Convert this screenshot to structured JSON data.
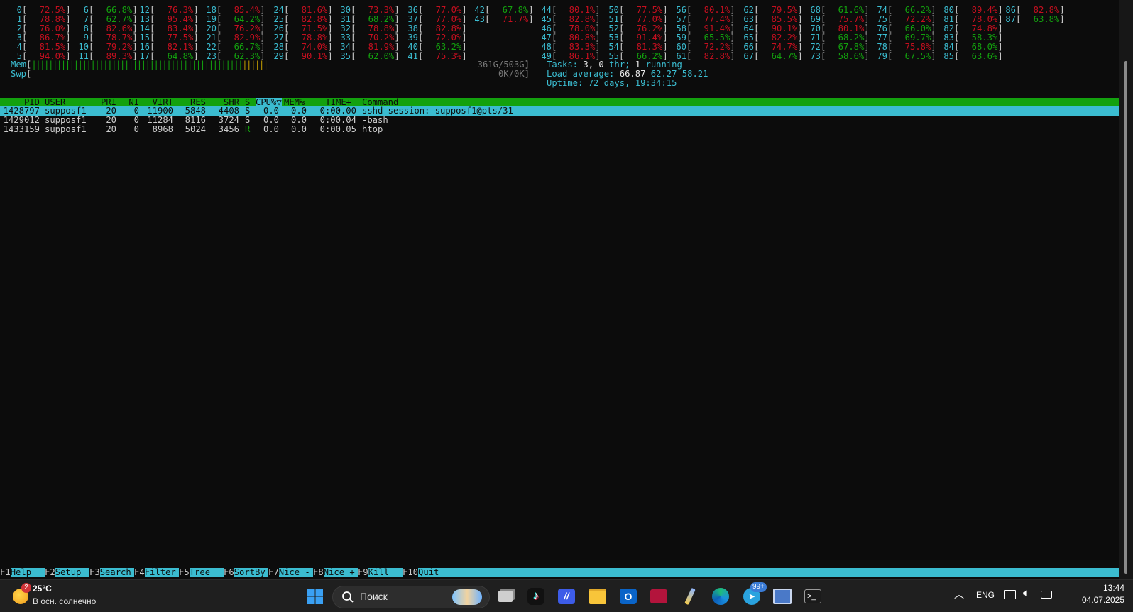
{
  "cpus": [
    {
      "n": "0",
      "v": "72.5%"
    },
    {
      "n": "1",
      "v": "78.8%"
    },
    {
      "n": "2",
      "v": "76.0%"
    },
    {
      "n": "3",
      "v": "86.7%"
    },
    {
      "n": "4",
      "v": "81.5%"
    },
    {
      "n": "5",
      "v": "94.0%"
    },
    {
      "n": "6",
      "v": "66.8%"
    },
    {
      "n": "7",
      "v": "62.7%"
    },
    {
      "n": "8",
      "v": "82.6%"
    },
    {
      "n": "9",
      "v": "78.7%"
    },
    {
      "n": "10",
      "v": "79.2%"
    },
    {
      "n": "11",
      "v": "89.3%"
    },
    {
      "n": "12",
      "v": "76.3%"
    },
    {
      "n": "13",
      "v": "95.4%"
    },
    {
      "n": "14",
      "v": "83.4%"
    },
    {
      "n": "15",
      "v": "77.5%"
    },
    {
      "n": "16",
      "v": "82.1%"
    },
    {
      "n": "17",
      "v": "64.8%"
    },
    {
      "n": "18",
      "v": "85.4%"
    },
    {
      "n": "19",
      "v": "64.2%"
    },
    {
      "n": "20",
      "v": "76.2%"
    },
    {
      "n": "21",
      "v": "82.9%"
    },
    {
      "n": "22",
      "v": "66.7%"
    },
    {
      "n": "23",
      "v": "62.3%"
    },
    {
      "n": "24",
      "v": "81.6%"
    },
    {
      "n": "25",
      "v": "82.8%"
    },
    {
      "n": "26",
      "v": "71.5%"
    },
    {
      "n": "27",
      "v": "78.8%"
    },
    {
      "n": "28",
      "v": "74.0%"
    },
    {
      "n": "29",
      "v": "90.1%"
    },
    {
      "n": "30",
      "v": "73.3%"
    },
    {
      "n": "31",
      "v": "68.2%"
    },
    {
      "n": "32",
      "v": "78.8%"
    },
    {
      "n": "33",
      "v": "70.2%"
    },
    {
      "n": "34",
      "v": "81.9%"
    },
    {
      "n": "35",
      "v": "62.0%"
    },
    {
      "n": "36",
      "v": "77.0%"
    },
    {
      "n": "37",
      "v": "77.0%"
    },
    {
      "n": "38",
      "v": "82.8%"
    },
    {
      "n": "39",
      "v": "72.0%"
    },
    {
      "n": "40",
      "v": "63.2%"
    },
    {
      "n": "41",
      "v": "75.3%"
    },
    {
      "n": "42",
      "v": "67.8%"
    },
    {
      "n": "43",
      "v": "71.7%"
    },
    {
      "n": "44",
      "v": "80.1%"
    },
    {
      "n": "45",
      "v": "82.8%"
    },
    {
      "n": "46",
      "v": "78.0%"
    },
    {
      "n": "47",
      "v": "80.8%"
    },
    {
      "n": "48",
      "v": "83.3%"
    },
    {
      "n": "49",
      "v": "86.1%"
    },
    {
      "n": "50",
      "v": "77.5%"
    },
    {
      "n": "51",
      "v": "77.0%"
    },
    {
      "n": "52",
      "v": "76.2%"
    },
    {
      "n": "53",
      "v": "91.4%"
    },
    {
      "n": "54",
      "v": "81.3%"
    },
    {
      "n": "55",
      "v": "66.2%"
    },
    {
      "n": "56",
      "v": "80.1%"
    },
    {
      "n": "57",
      "v": "77.4%"
    },
    {
      "n": "58",
      "v": "91.4%"
    },
    {
      "n": "59",
      "v": "65.5%"
    },
    {
      "n": "60",
      "v": "72.2%"
    },
    {
      "n": "61",
      "v": "82.8%"
    },
    {
      "n": "62",
      "v": "79.5%"
    },
    {
      "n": "63",
      "v": "85.5%"
    },
    {
      "n": "64",
      "v": "90.1%"
    },
    {
      "n": "65",
      "v": "82.2%"
    },
    {
      "n": "66",
      "v": "74.7%"
    },
    {
      "n": "67",
      "v": "64.7%"
    },
    {
      "n": "68",
      "v": "61.6%"
    },
    {
      "n": "69",
      "v": "75.7%"
    },
    {
      "n": "70",
      "v": "80.1%"
    },
    {
      "n": "71",
      "v": "68.2%"
    },
    {
      "n": "72",
      "v": "67.8%"
    },
    {
      "n": "73",
      "v": "58.6%"
    },
    {
      "n": "74",
      "v": "66.2%"
    },
    {
      "n": "75",
      "v": "72.2%"
    },
    {
      "n": "76",
      "v": "66.0%"
    },
    {
      "n": "77",
      "v": "69.7%"
    },
    {
      "n": "78",
      "v": "75.8%"
    },
    {
      "n": "79",
      "v": "67.5%"
    },
    {
      "n": "80",
      "v": "89.4%"
    },
    {
      "n": "81",
      "v": "78.0%"
    },
    {
      "n": "82",
      "v": "74.8%"
    },
    {
      "n": "83",
      "v": "58.3%"
    },
    {
      "n": "84",
      "v": "68.0%"
    },
    {
      "n": "85",
      "v": "63.6%"
    },
    {
      "n": "86",
      "v": "82.8%"
    },
    {
      "n": "87",
      "v": "63.8%"
    }
  ],
  "meters": {
    "mem_label": "Mem",
    "mem_value": "361G/503G",
    "mem_used_fraction": 0.718,
    "swp_label": "Swp",
    "swp_value": "0K/0K",
    "tasks_label": "Tasks:",
    "tasks_value": "3,",
    "thr_value": "0",
    "thr_label": "thr;",
    "running_value": "1",
    "running_label": "running",
    "load_label": "Load average:",
    "load1": "66.87",
    "load5": "62.27",
    "load15": "58.21",
    "uptime_label": "Uptime:",
    "uptime_value": "72 days, 19:34:15"
  },
  "columns": {
    "pid": "PID",
    "user": "USER",
    "pri": "PRI",
    "ni": "NI",
    "virt": "VIRT",
    "res": "RES",
    "shr": "SHR",
    "s": "S",
    "cpu": "CPU%",
    "sort_mark": "▽",
    "mem": "MEM%",
    "time": "TIME+",
    "command": "Command"
  },
  "processes": [
    {
      "pid": "1428797",
      "user": "supposf1",
      "pri": "20",
      "ni": "0",
      "virt": "11900",
      "res": "5848",
      "shr": "4408",
      "s": "S",
      "cpu": "0.0",
      "mem": "0.0",
      "time": "0:00.00",
      "command": "sshd-session: supposf1@pts/31"
    },
    {
      "pid": "1429012",
      "user": "supposf1",
      "pri": "20",
      "ni": "0",
      "virt": "11284",
      "res": "8116",
      "shr": "3724",
      "s": "S",
      "cpu": "0.0",
      "mem": "0.0",
      "time": "0:00.04",
      "command": "-bash"
    },
    {
      "pid": "1433159",
      "user": "supposf1",
      "pri": "20",
      "ni": "0",
      "virt": "8968",
      "res": "5024",
      "shr": "3456",
      "s": "R",
      "cpu": "0.0",
      "mem": "0.0",
      "time": "0:00.05",
      "command": "htop"
    }
  ],
  "fkeys": [
    {
      "key": "F1",
      "label": "Help"
    },
    {
      "key": "F2",
      "label": "Setup"
    },
    {
      "key": "F3",
      "label": "Search"
    },
    {
      "key": "F4",
      "label": "Filter"
    },
    {
      "key": "F5",
      "label": "Tree"
    },
    {
      "key": "F6",
      "label": "SortBy"
    },
    {
      "key": "F7",
      "label": "Nice -"
    },
    {
      "key": "F8",
      "label": "Nice +"
    },
    {
      "key": "F9",
      "label": "Kill"
    },
    {
      "key": "F10",
      "label": "Quit"
    }
  ],
  "taskbar": {
    "weather_temp": "25°C",
    "weather_desc": "В осн. солнечно",
    "weather_badge": "2",
    "search_placeholder": "Поиск",
    "telegram_badge": "99+",
    "lang": "ENG",
    "time": "13:44",
    "date": "04.07.2025"
  },
  "colors": {
    "terminal_bg": "#0c0c0c",
    "cyan": "#3bbcd0",
    "green": "#13a10e",
    "red": "#c50f1f",
    "taskbar_bg": "#1f1f1f"
  }
}
